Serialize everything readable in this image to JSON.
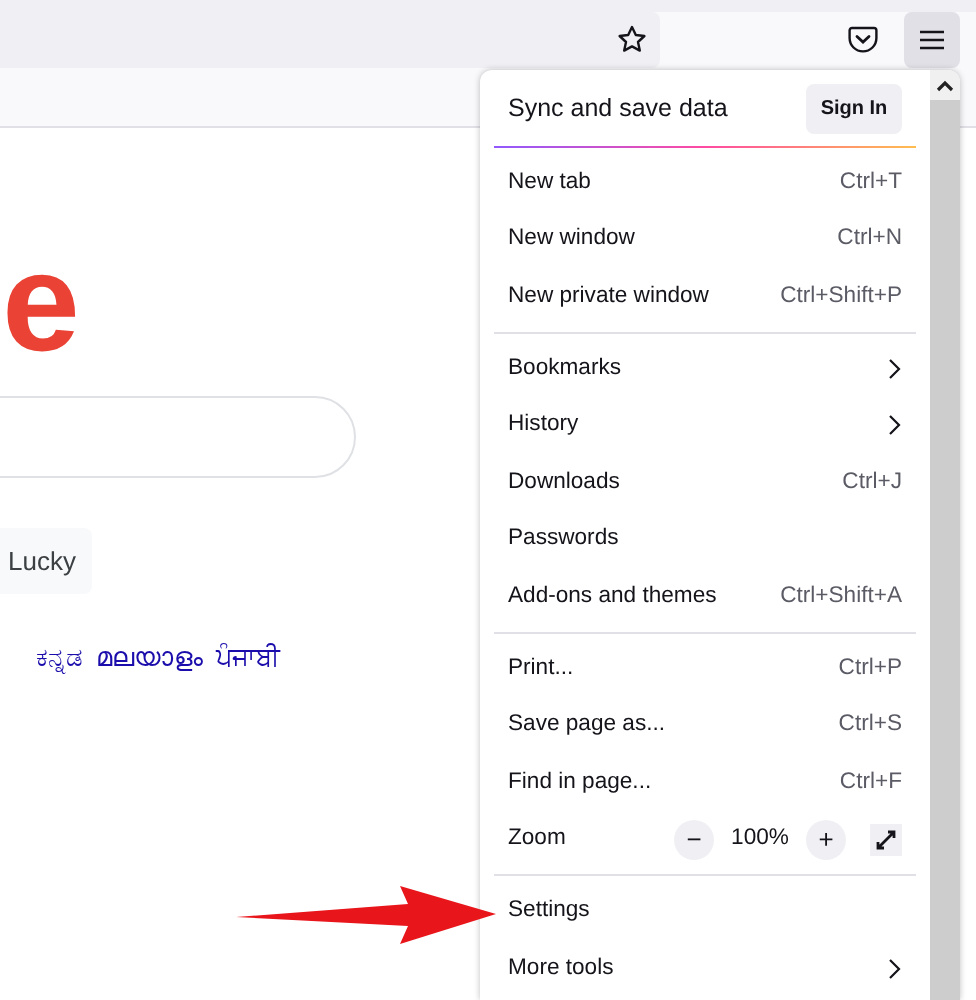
{
  "toolbar": {
    "menu_button_pressed": true
  },
  "page": {
    "logo": "e",
    "button": "Lucky",
    "languages": [
      "ಕನ್ನಡ",
      "മലയാളം",
      "ਪੰਜਾਬੀ"
    ]
  },
  "menu": {
    "header": {
      "title": "Sync and save data",
      "button": "Sign In"
    },
    "sections": [
      [
        {
          "label": "New tab",
          "kind": "shortcut",
          "shortcut": "Ctrl+T"
        },
        {
          "label": "New window",
          "kind": "shortcut",
          "shortcut": "Ctrl+N"
        },
        {
          "label": "New private window",
          "kind": "shortcut",
          "shortcut": "Ctrl+Shift+P"
        }
      ],
      [
        {
          "label": "Bookmarks",
          "kind": "submenu"
        },
        {
          "label": "History",
          "kind": "submenu"
        },
        {
          "label": "Downloads",
          "kind": "shortcut",
          "shortcut": "Ctrl+J"
        },
        {
          "label": "Passwords",
          "kind": "plain"
        },
        {
          "label": "Add-ons and themes",
          "kind": "shortcut",
          "shortcut": "Ctrl+Shift+A"
        }
      ],
      [
        {
          "label": "Print...",
          "kind": "shortcut",
          "shortcut": "Ctrl+P"
        },
        {
          "label": "Save page as...",
          "kind": "shortcut",
          "shortcut": "Ctrl+S"
        },
        {
          "label": "Find in page...",
          "kind": "shortcut",
          "shortcut": "Ctrl+F"
        },
        {
          "label": "Zoom",
          "kind": "zoom",
          "minus": "−",
          "value": "100%",
          "plus": "+"
        }
      ],
      [
        {
          "label": "Settings",
          "kind": "plain"
        },
        {
          "label": "More tools",
          "kind": "submenu"
        }
      ]
    ]
  }
}
